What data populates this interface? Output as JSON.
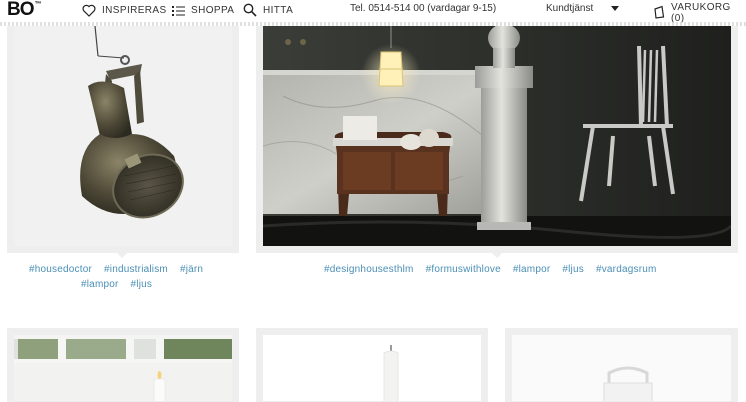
{
  "header": {
    "logo": "BO",
    "logo_mark": "™",
    "nav": [
      {
        "label": "INSPIRERAS",
        "icon": "heart-icon"
      },
      {
        "label": "SHOPPA",
        "icon": "list-icon"
      },
      {
        "label": "HITTA",
        "icon": "search-icon"
      }
    ],
    "phone": "Tel. 0514-514 00 (vardagar 9-15)",
    "service": "Kundtjänst",
    "cart": "VARUKORG (0)"
  },
  "cards": [
    {
      "tags": [
        "#housedoctor",
        "#industrialism",
        "#järn",
        "#lampor",
        "#ljus"
      ]
    },
    {
      "tags": [
        "#designhousesthlm",
        "#formuswithlove",
        "#lampor",
        "#ljus",
        "#vardagsrum"
      ]
    }
  ],
  "colors": {
    "tag": "#4b8fb5",
    "frame": "#eeeeee"
  }
}
